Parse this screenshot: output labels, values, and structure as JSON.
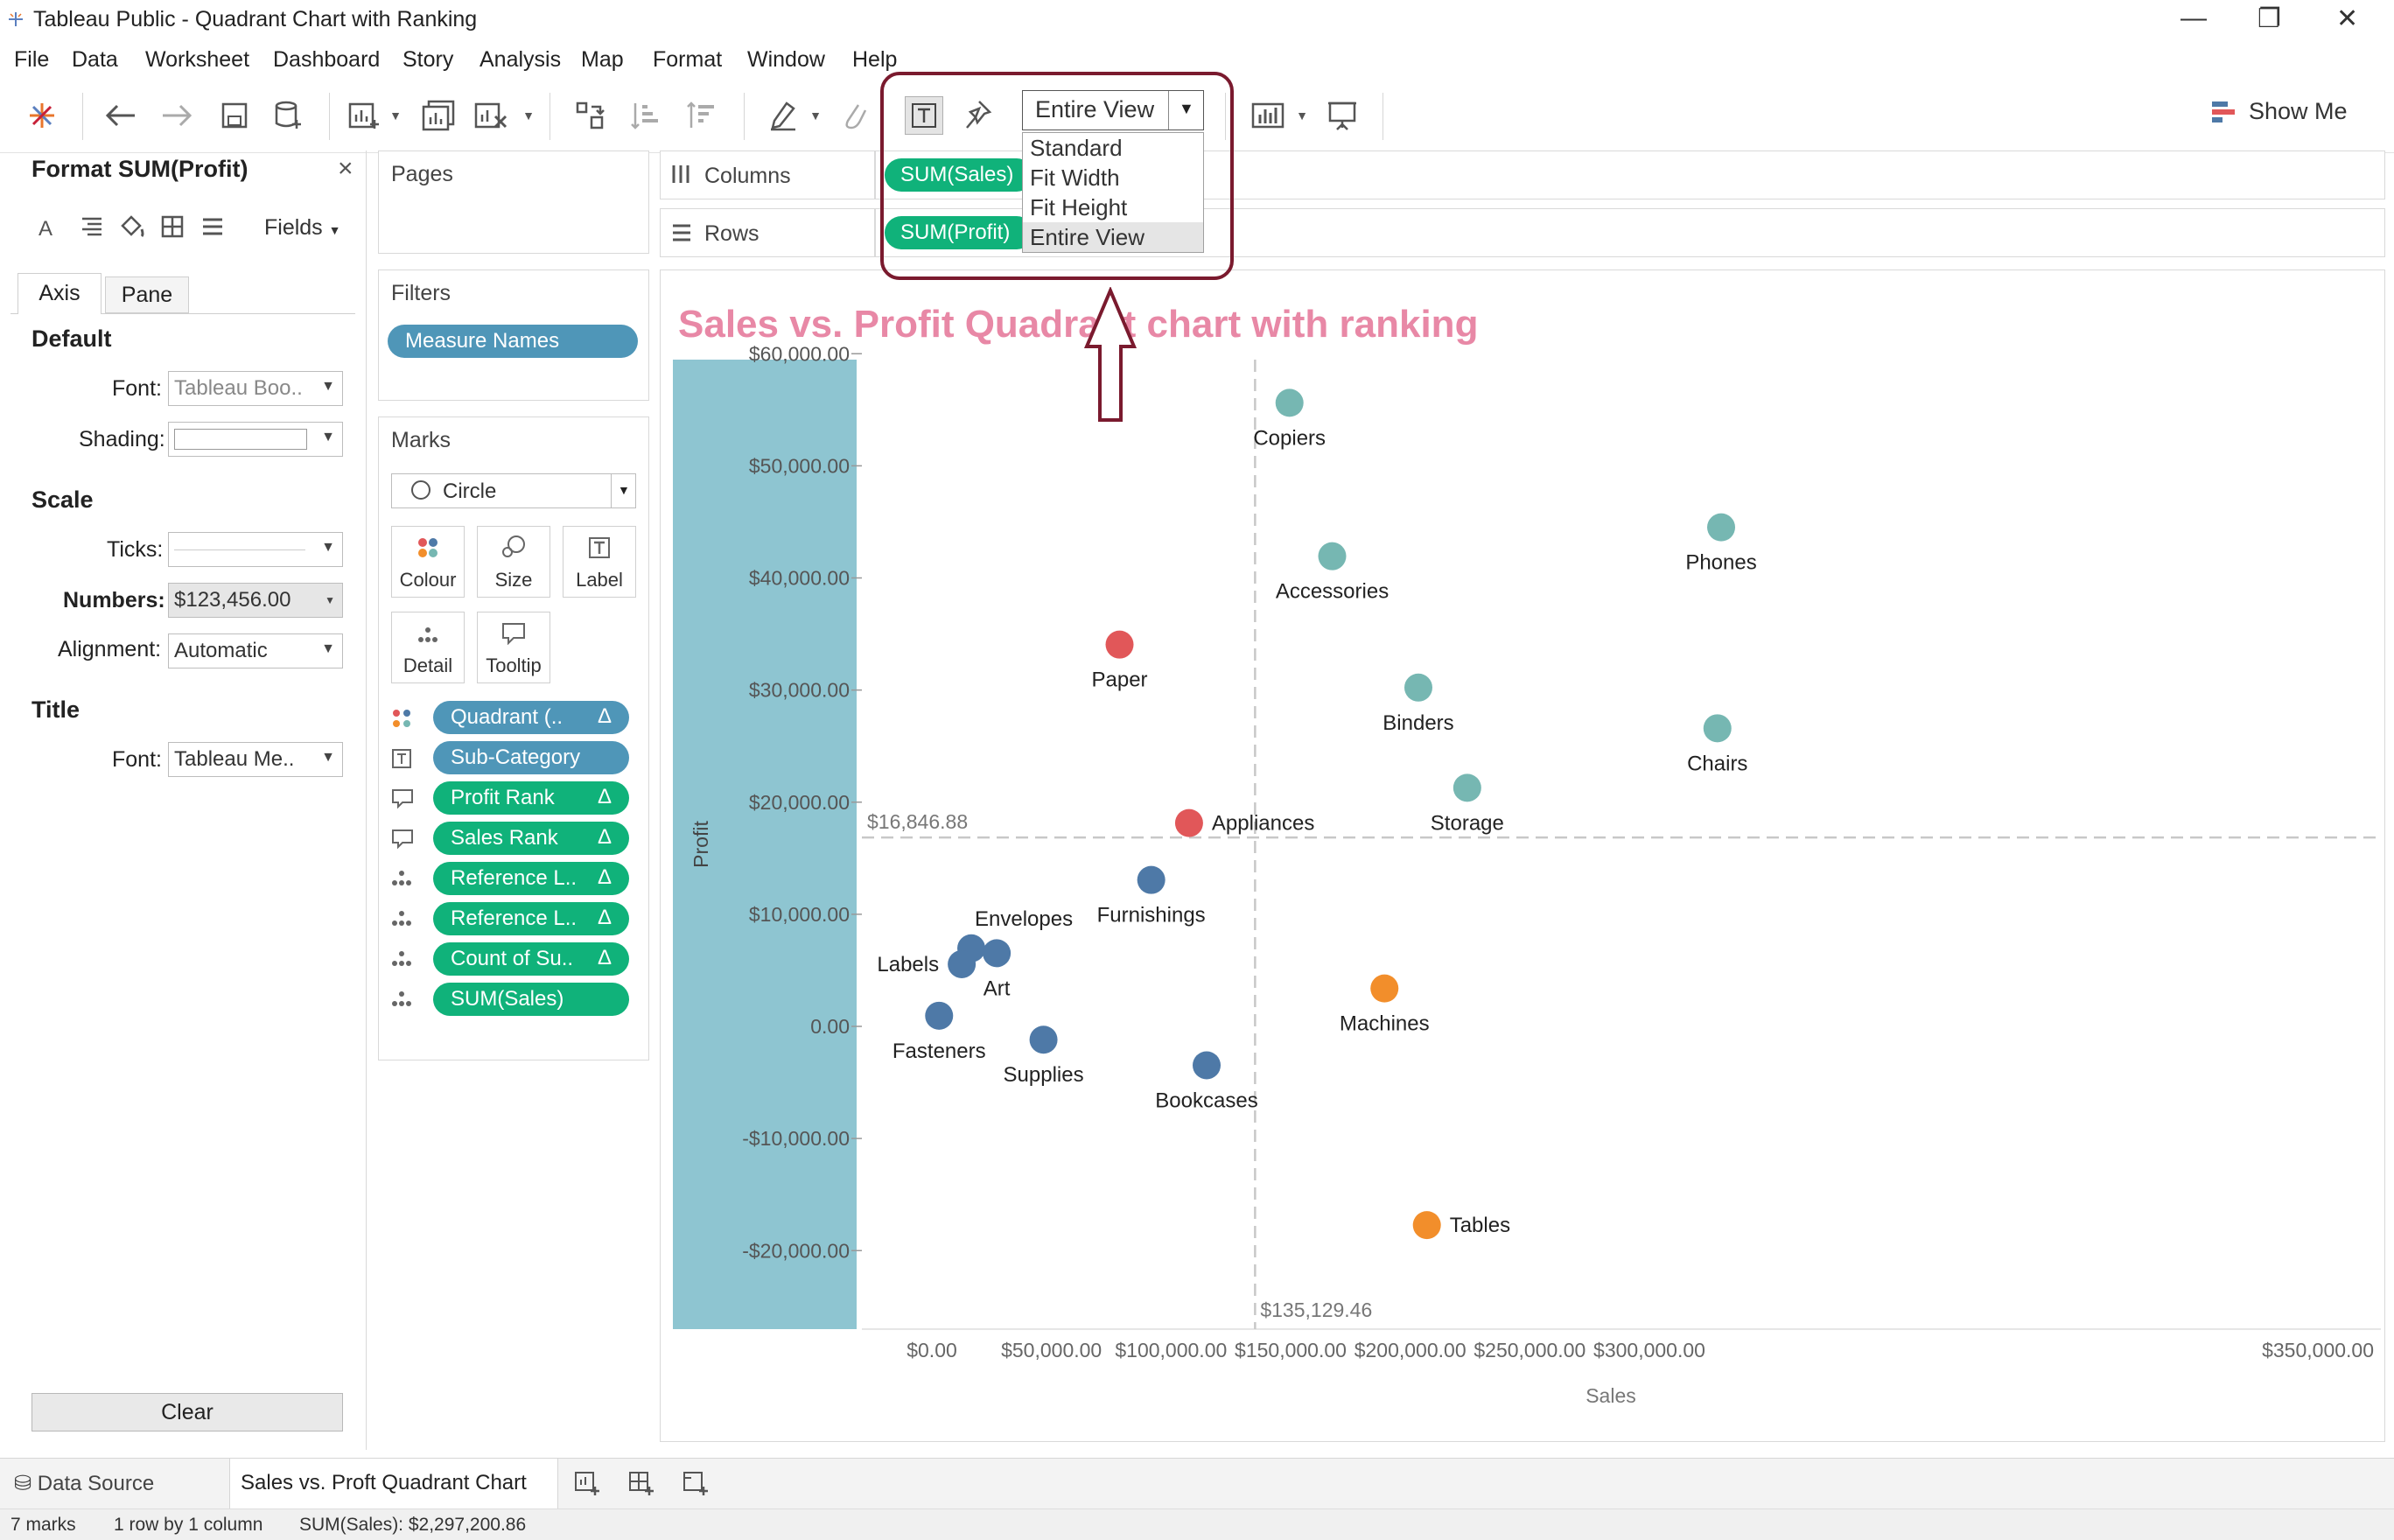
{
  "window": {
    "title": "Tableau Public - Quadrant Chart with Ranking",
    "minimize": "—",
    "restore": "❐",
    "close": "✕"
  },
  "menu": [
    "File",
    "Data",
    "Worksheet",
    "Dashboard",
    "Story",
    "Analysis",
    "Map",
    "Format",
    "Window",
    "Help"
  ],
  "toolbar": {
    "fit_value": "Entire View",
    "fit_options": [
      "Standard",
      "Fit Width",
      "Fit Height",
      "Entire View"
    ],
    "fit_selected_index": 3,
    "show_me": "Show Me",
    "icons": [
      "tableau-logo-icon",
      "undo-icon",
      "redo-icon",
      "save-icon",
      "new-datasource-icon",
      "new-worksheet-icon",
      "duplicate-sheet-icon",
      "clear-sheet-icon",
      "swap-icon",
      "sort-asc-icon",
      "sort-desc-icon",
      "highlight-icon",
      "group-icon",
      "labels-icon",
      "fix-axes-icon",
      "chart-type-icon",
      "presentation-icon"
    ]
  },
  "format_pane": {
    "title": "Format SUM(Profit)",
    "close": "×",
    "fields_label": "Fields",
    "tabs": [
      "Axis",
      "Pane"
    ],
    "active_tab": "Axis",
    "default_heading": "Default",
    "font_label": "Font:",
    "font_value": "Tableau Boo..",
    "shading_label": "Shading:",
    "scale_heading": "Scale",
    "ticks_label": "Ticks:",
    "numbers_label": "Numbers:",
    "numbers_value": "$123,456.00",
    "alignment_label": "Alignment:",
    "alignment_value": "Automatic",
    "title_heading": "Title",
    "title_font_label": "Font:",
    "title_font_value": "Tableau Me..",
    "clear_button": "Clear"
  },
  "cards": {
    "pages": "Pages",
    "filters": "Filters",
    "filter_pill": "Measure Names",
    "marks": "Marks",
    "mark_type": "Circle",
    "mark_buttons": [
      "Colour",
      "Size",
      "Label",
      "Detail",
      "Tooltip"
    ],
    "mark_fields": [
      {
        "label": "Quadrant (..",
        "color": "blue",
        "delta": "Δ"
      },
      {
        "label": "Sub-Category",
        "color": "blue",
        "delta": ""
      },
      {
        "label": "Profit Rank",
        "color": "green",
        "delta": "Δ"
      },
      {
        "label": "Sales Rank",
        "color": "green",
        "delta": "Δ"
      },
      {
        "label": "Reference L..",
        "color": "green",
        "delta": "Δ"
      },
      {
        "label": "Reference L..",
        "color": "green",
        "delta": "Δ"
      },
      {
        "label": "Count of Su..",
        "color": "green",
        "delta": "Δ"
      },
      {
        "label": "SUM(Sales)",
        "color": "green",
        "delta": ""
      }
    ]
  },
  "shelves": {
    "columns_label": "Columns",
    "columns_pill": "SUM(Sales)",
    "rows_label": "Rows",
    "rows_pill": "SUM(Profit)"
  },
  "chart_data": {
    "type": "scatter",
    "title": "Sales vs. Profit Quadrant chart with ranking",
    "xlabel": "Sales",
    "ylabel": "Profit",
    "xlim": [
      -20000,
      350000
    ],
    "ylim": [
      -22000,
      62000
    ],
    "xticks": [
      0,
      50000,
      100000,
      150000,
      200000,
      250000,
      300000,
      350000
    ],
    "xtick_labels": [
      "$0.00",
      "$50,000.00",
      "$100,000.00",
      "$150,000.00",
      "$200,000.00",
      "$250,000.00",
      "$300,000.00",
      "$350,000.00"
    ],
    "yticks": [
      60000,
      50000,
      40000,
      30000,
      20000,
      10000,
      0,
      -10000,
      -20000
    ],
    "ytick_labels": [
      "$60,000.00",
      "$50,000.00",
      "$40,000.00",
      "$30,000.00",
      "$20,000.00",
      "$10,000.00",
      "0.00",
      "-$10,000.00",
      "-$20,000.00"
    ],
    "ref_x": 135129.46,
    "ref_x_label": "$135,129.46",
    "ref_y": 16846.88,
    "ref_y_label": "$16,846.88",
    "colors": {
      "teal": "#76b7b2",
      "red": "#e15759",
      "blue": "#4e79a7",
      "orange": "#f28e2b",
      "band": "#8ec5d1"
    },
    "points": [
      {
        "name": "Copiers",
        "x": 149528,
        "y": 55618,
        "color": "teal",
        "label_pos": "below"
      },
      {
        "name": "Accessories",
        "x": 167380,
        "y": 41937,
        "color": "teal",
        "label_pos": "below"
      },
      {
        "name": "Phones",
        "x": 330007,
        "y": 44516,
        "color": "teal",
        "label_pos": "below"
      },
      {
        "name": "Binders",
        "x": 203413,
        "y": 30222,
        "color": "teal",
        "label_pos": "below"
      },
      {
        "name": "Chairs",
        "x": 328449,
        "y": 26590,
        "color": "teal",
        "label_pos": "below"
      },
      {
        "name": "Storage",
        "x": 223844,
        "y": 21279,
        "color": "teal",
        "label_pos": "below"
      },
      {
        "name": "Paper",
        "x": 78479,
        "y": 34054,
        "color": "red",
        "label_pos": "below"
      },
      {
        "name": "Appliances",
        "x": 107532,
        "y": 18138,
        "color": "red",
        "label_pos": "right"
      },
      {
        "name": "Furnishings",
        "x": 91705,
        "y": 13059,
        "color": "blue",
        "label_pos": "below"
      },
      {
        "name": "Envelopes",
        "x": 16476,
        "y": 6964,
        "color": "blue",
        "label_pos": "aboveright"
      },
      {
        "name": "Labels",
        "x": 12486,
        "y": 5546,
        "color": "blue",
        "label_pos": "left"
      },
      {
        "name": "Art",
        "x": 27119,
        "y": 6528,
        "color": "blue",
        "label_pos": "below"
      },
      {
        "name": "Fasteners",
        "x": 3024,
        "y": 950,
        "color": "blue",
        "label_pos": "below"
      },
      {
        "name": "Supplies",
        "x": 46674,
        "y": -1189,
        "color": "blue",
        "label_pos": "below"
      },
      {
        "name": "Bookcases",
        "x": 114880,
        "y": -3473,
        "color": "blue",
        "label_pos": "below"
      },
      {
        "name": "Machines",
        "x": 189239,
        "y": 3385,
        "color": "orange",
        "label_pos": "below"
      },
      {
        "name": "Tables",
        "x": 206966,
        "y": -17725,
        "color": "orange",
        "label_pos": "right"
      }
    ]
  },
  "tabs": {
    "data_source": "Data Source",
    "sheet": "Sales vs. Proft Quadrant Chart"
  },
  "status": {
    "marks": "7 marks",
    "rows": "1 row by 1 column",
    "sum": "SUM(Sales): $2,297,200.86"
  }
}
